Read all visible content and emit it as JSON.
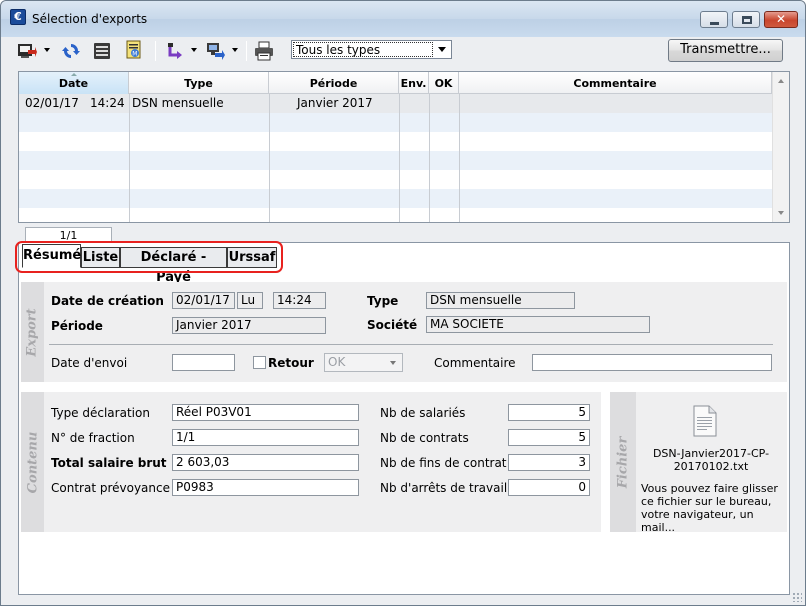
{
  "window": {
    "title": "Sélection d'exports",
    "app_icon_letter": "€"
  },
  "toolbar": {
    "icons": [
      "export-icon",
      "refresh-icon",
      "list-icon",
      "report-icon",
      "import-icon",
      "network-icon",
      "print-icon"
    ],
    "type_filter": "Tous les types",
    "transmit_label": "Transmettre..."
  },
  "table": {
    "columns": [
      "Date",
      "Type",
      "Période",
      "Env.",
      "OK",
      "Commentaire"
    ],
    "rows": [
      {
        "date": "02/01/17",
        "time": "14:24",
        "type": "DSN mensuelle",
        "period": "Janvier 2017",
        "env": "",
        "ok": "",
        "comment": ""
      }
    ],
    "counter": "1/1"
  },
  "tabs": [
    "Résumé",
    "Liste",
    "Déclaré - Payé",
    "Urssaf"
  ],
  "export": {
    "section_label": "Export",
    "creation_label": "Date de création",
    "creation_date": "02/01/17",
    "creation_day": "Lu",
    "creation_time": "14:24",
    "type_label": "Type",
    "type_value": "DSN mensuelle",
    "period_label": "Période",
    "period_value": "Janvier 2017",
    "company_label": "Société",
    "company_value": "MA SOCIETE",
    "send_date_label": "Date d'envoi",
    "send_date_value": "",
    "return_label": "Retour",
    "return_status": "OK",
    "comment_label": "Commentaire",
    "comment_value": ""
  },
  "content": {
    "section_label": "Contenu",
    "decl_type_label": "Type déclaration",
    "decl_type_value": "Réel P03V01",
    "fraction_label": "N° de fraction",
    "fraction_value": "1/1",
    "gross_label": "Total salaire brut",
    "gross_value": "2 603,03",
    "contract_label": "Contrat prévoyance",
    "contract_value": "P0983",
    "employees_label": "Nb de salariés",
    "employees_value": "5",
    "contracts_label": "Nb de contrats",
    "contracts_value": "5",
    "ends_label": "Nb de fins de contrat",
    "ends_value": "3",
    "stops_label": "Nb d'arrêts de travail",
    "stops_value": "0"
  },
  "file": {
    "section_label": "Fichier",
    "name": "DSN-Janvier2017-CP-20170102.txt",
    "name_line1": "DSN-Janvier2017-CP-",
    "name_line2": "20170102.txt",
    "hint": "Vous pouvez faire glisser ce fichier sur le bureau, votre navigateur, un mail..."
  },
  "colors": {
    "accent_highlight": "#e8221f",
    "selected_header": "#c9e3f6",
    "alt_row": "#eaf1f9"
  }
}
